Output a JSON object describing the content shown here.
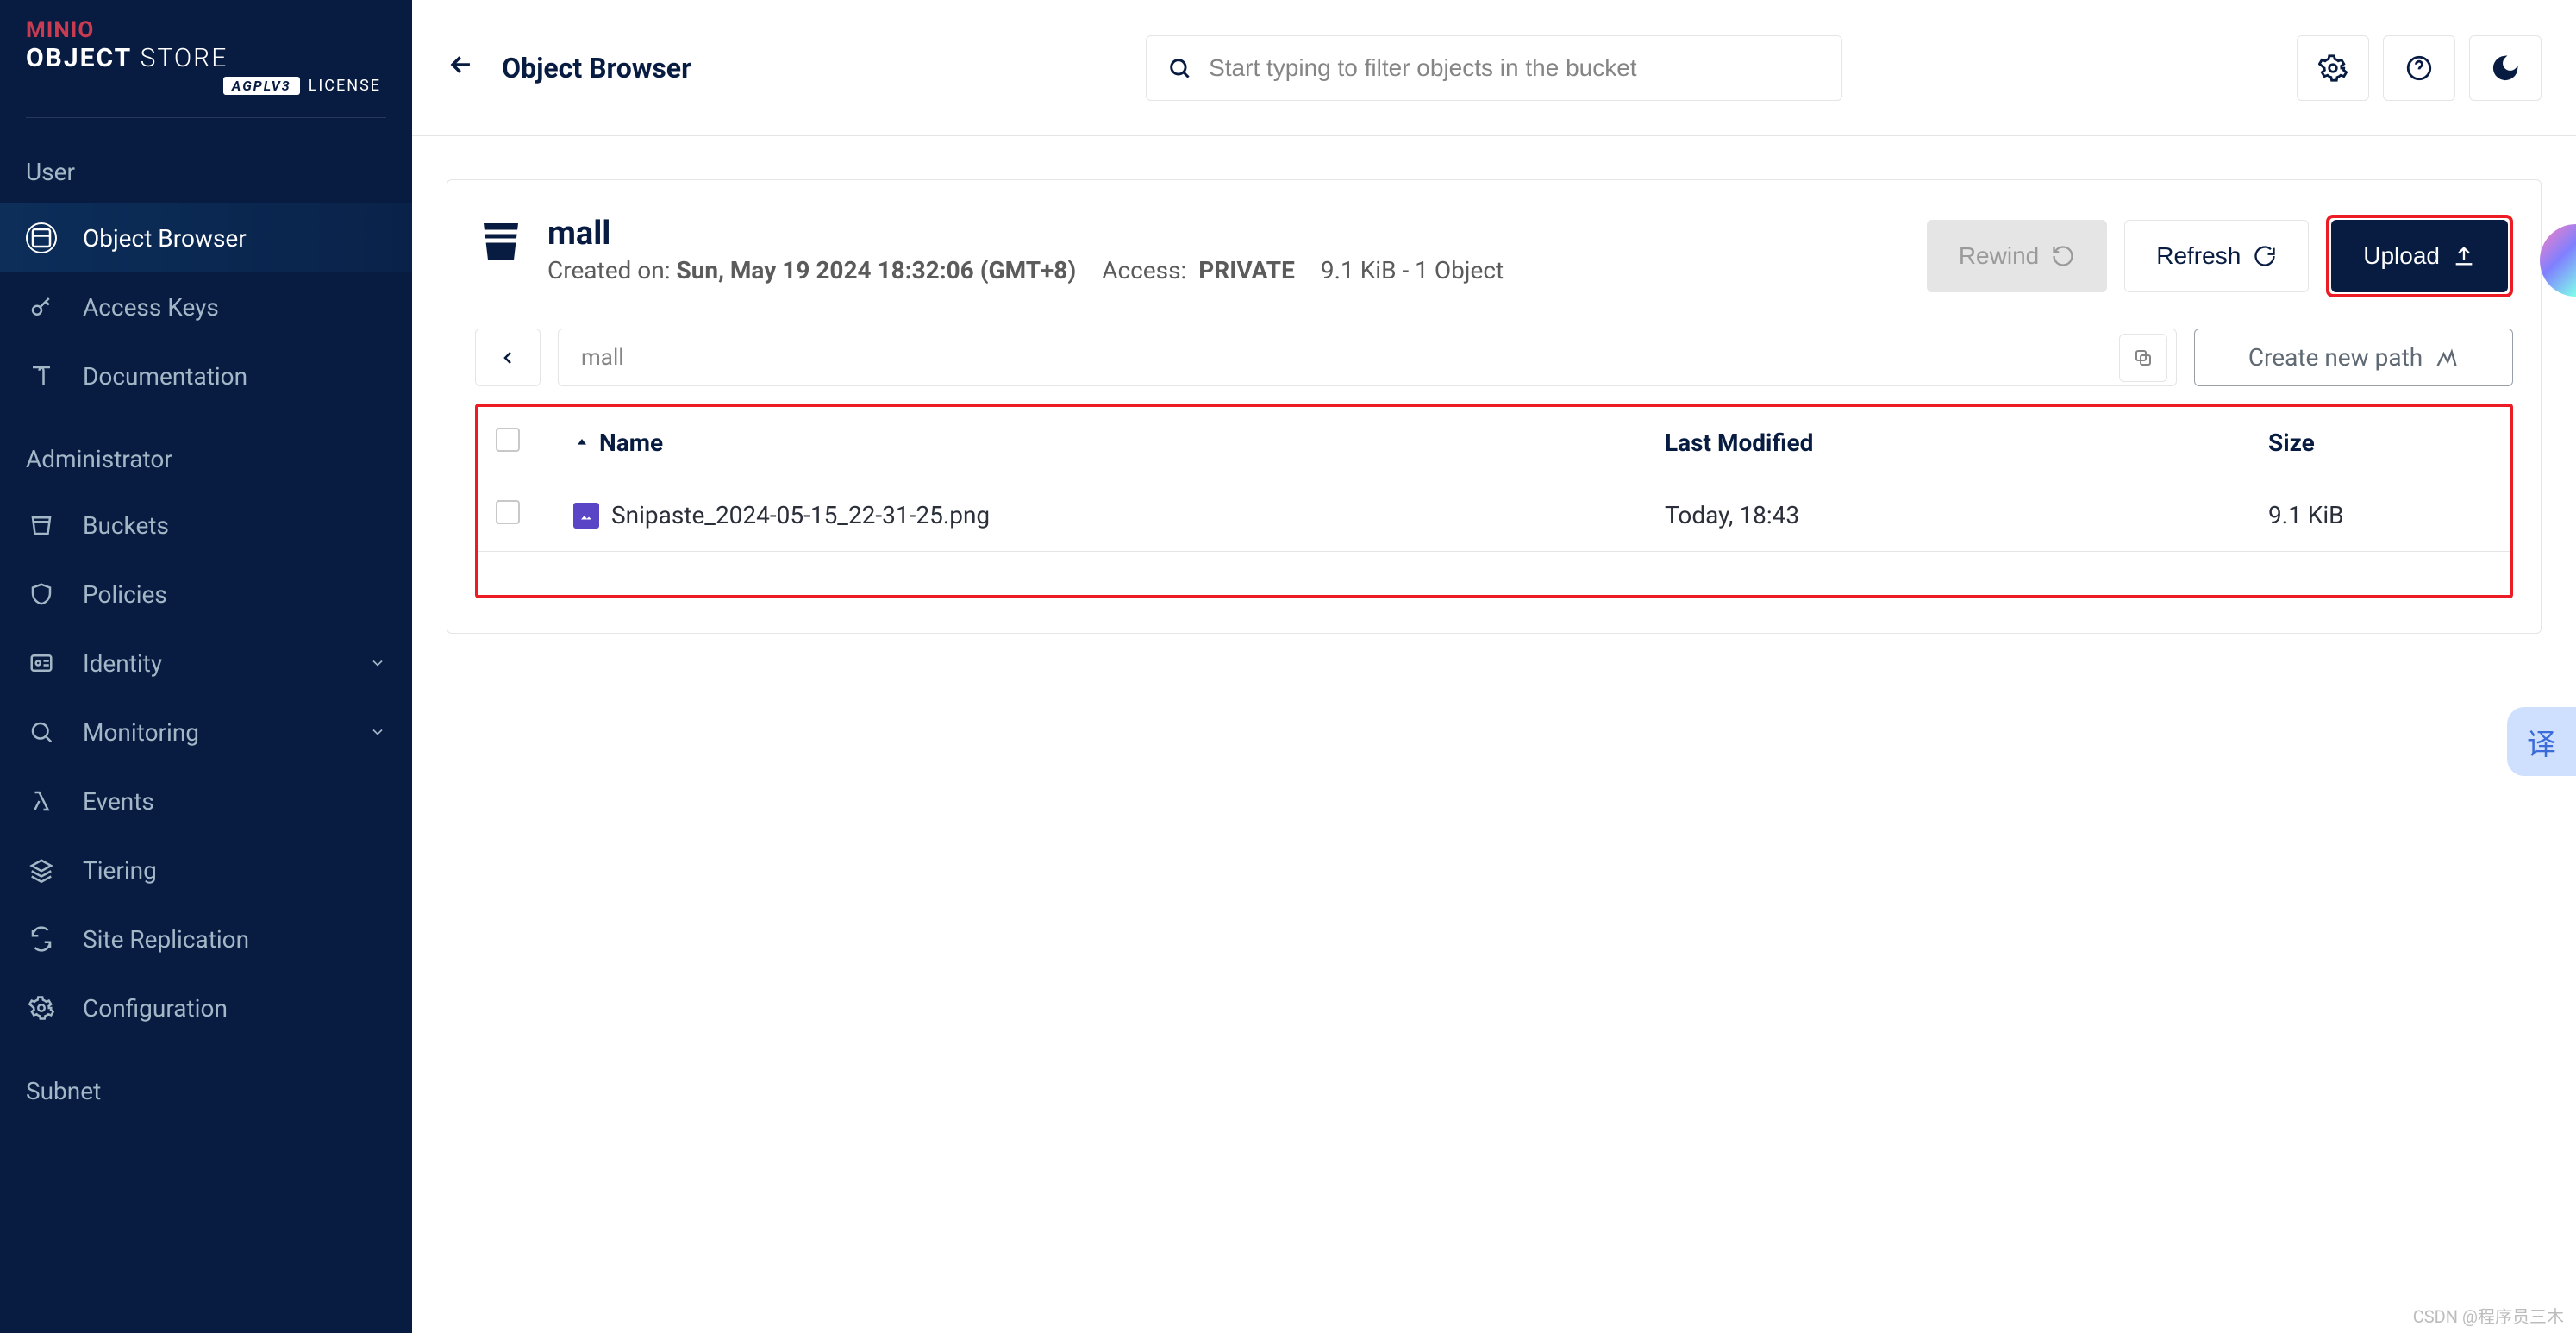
{
  "brand": {
    "name_top": "MINIO",
    "name_main_bold": "OBJECT",
    "name_main_light": " STORE",
    "license_badge": "AGPLV3",
    "license_text": "LICENSE"
  },
  "sidebar": {
    "sections": {
      "user": {
        "title": "User",
        "items": [
          {
            "label": "Object Browser"
          },
          {
            "label": "Access Keys"
          },
          {
            "label": "Documentation"
          }
        ]
      },
      "admin": {
        "title": "Administrator",
        "items": [
          {
            "label": "Buckets"
          },
          {
            "label": "Policies"
          },
          {
            "label": "Identity"
          },
          {
            "label": "Monitoring"
          },
          {
            "label": "Events"
          },
          {
            "label": "Tiering"
          },
          {
            "label": "Site Replication"
          },
          {
            "label": "Configuration"
          }
        ]
      },
      "subnet": {
        "title": "Subnet"
      }
    }
  },
  "header": {
    "title": "Object Browser",
    "search_placeholder": "Start typing to filter objects in the bucket"
  },
  "bucket": {
    "name": "mall",
    "created_label": "Created on:",
    "created_value": "Sun, May 19 2024 18:32:06 (GMT+8)",
    "access_label": "Access:",
    "access_value": "PRIVATE",
    "stats": "9.1 KiB - 1 Object",
    "actions": {
      "rewind": "Rewind",
      "refresh": "Refresh",
      "upload": "Upload",
      "create_path": "Create new path"
    },
    "breadcrumb": "mall"
  },
  "table": {
    "columns": {
      "name": "Name",
      "modified": "Last Modified",
      "size": "Size"
    },
    "rows": [
      {
        "name": "Snipaste_2024-05-15_22-31-25.png",
        "modified": "Today, 18:43",
        "size": "9.1 KiB"
      }
    ]
  },
  "misc": {
    "translate": "译",
    "watermark": "CSDN @程序员三木"
  }
}
